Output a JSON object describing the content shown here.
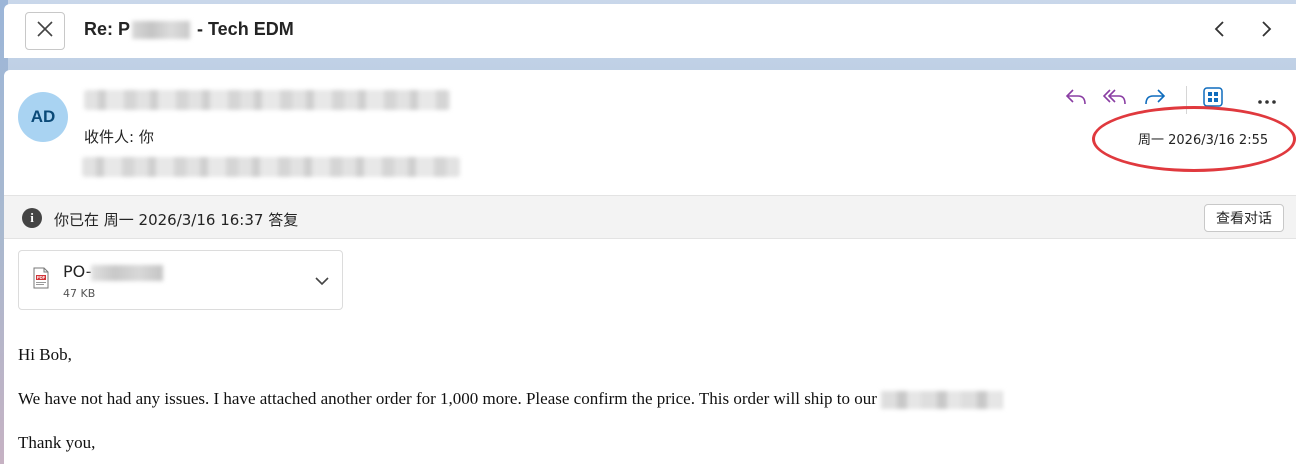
{
  "header": {
    "subject_prefix": "Re: P",
    "subject_suffix": " - Tech EDM",
    "close_icon": "close-icon",
    "prev_icon": "chevron-left-icon",
    "next_icon": "chevron-right-icon"
  },
  "message": {
    "avatar_initials": "AD",
    "recipient_label": "收件人:",
    "recipient_value": "你",
    "timestamp": "周一 2026/3/16 2:55",
    "actions": [
      "reply-icon",
      "reply-all-icon",
      "forward-icon",
      "apps-icon",
      "more-icon"
    ],
    "accent_color": "#8a3ea3",
    "forward_color": "#0f6cbd",
    "highlight_color": "#e0393e"
  },
  "infobar": {
    "text": "你已在 周一 2026/3/16 16:37 答复",
    "button_label": "查看对话"
  },
  "attachment": {
    "name_prefix": "PO-",
    "size": "47 KB",
    "type_label": "PDF"
  },
  "body": {
    "greeting": "Hi Bob,",
    "line1": "We have not had any issues.  I have attached another order for 1,000 more.  Please confirm the price.  This order will ship to our ",
    "closing": "Thank you,"
  }
}
